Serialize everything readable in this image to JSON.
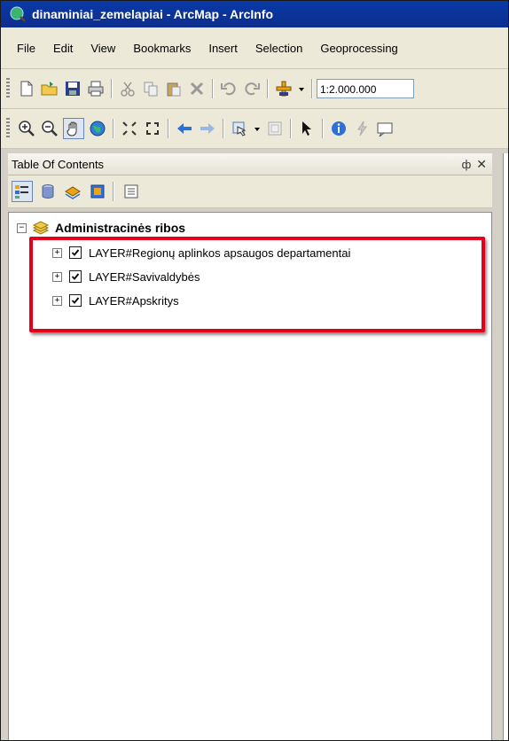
{
  "window": {
    "title": "dinaminiai_zemelapiai - ArcMap - ArcInfo"
  },
  "menubar": {
    "items": [
      "File",
      "Edit",
      "View",
      "Bookmarks",
      "Insert",
      "Selection",
      "Geoprocessing"
    ]
  },
  "toolbar": {
    "scale_value": "1:2.000.000"
  },
  "toc": {
    "title": "Table Of Contents",
    "pin": "ф",
    "close": "✕",
    "group": {
      "expander": "−",
      "label": "Administracinės ribos"
    },
    "layers": [
      {
        "expander": "+",
        "label": "LAYER#Regionų aplinkos apsaugos departamentai",
        "checked": true
      },
      {
        "expander": "+",
        "label": "LAYER#Savivaldybės",
        "checked": true
      },
      {
        "expander": "+",
        "label": "LAYER#Apskritys",
        "checked": true
      }
    ]
  },
  "colors": {
    "title_bar": "#0a3aa8",
    "highlight": "#e3001b",
    "chrome": "#ece9d8"
  }
}
